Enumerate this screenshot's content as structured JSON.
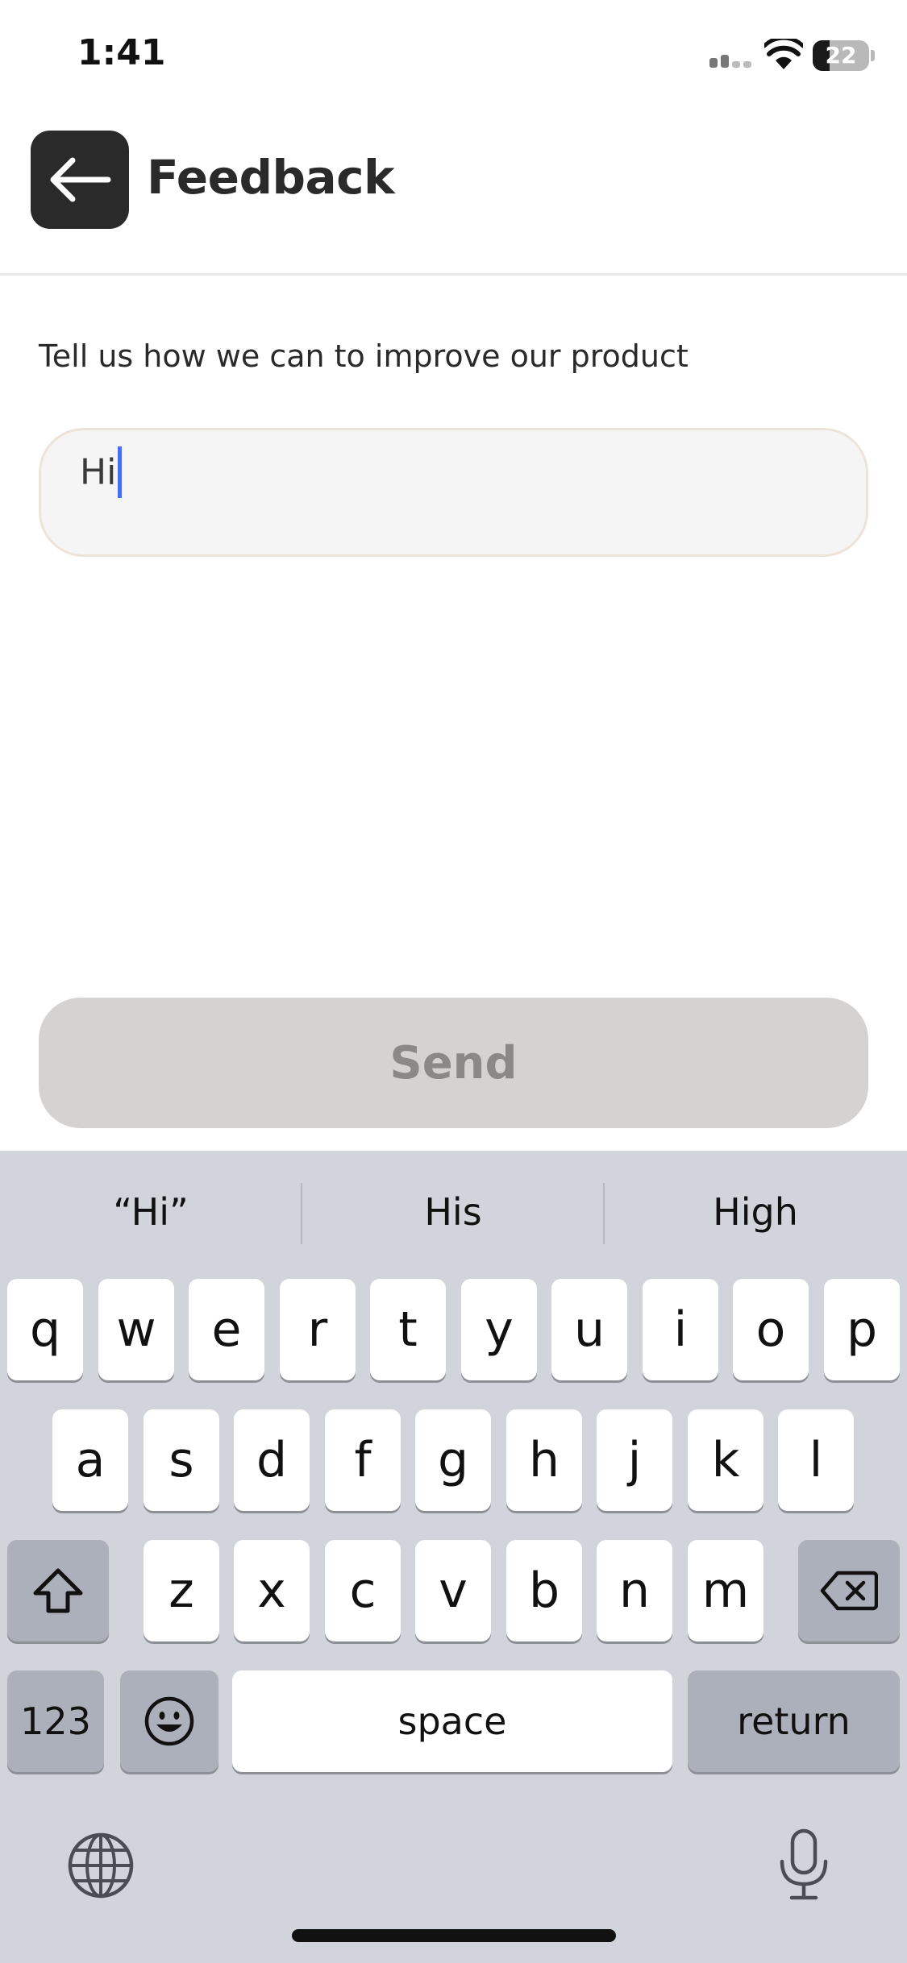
{
  "status_bar": {
    "time": "1:41",
    "battery": "22"
  },
  "header": {
    "title": "Feedback"
  },
  "main": {
    "prompt": "Tell us how we can to improve our product",
    "feedback_value": "Hi",
    "send_label": "Send"
  },
  "keyboard": {
    "suggestions": [
      "“Hi”",
      "His",
      "High"
    ],
    "row1": [
      "q",
      "w",
      "e",
      "r",
      "t",
      "y",
      "u",
      "i",
      "o",
      "p"
    ],
    "row2": [
      "a",
      "s",
      "d",
      "f",
      "g",
      "h",
      "j",
      "k",
      "l"
    ],
    "row3": [
      "z",
      "x",
      "c",
      "v",
      "b",
      "n",
      "m"
    ],
    "numbers_label": "123",
    "space_label": "space",
    "return_label": "return"
  },
  "icons": {
    "back": "arrow-left-icon",
    "shift": "shift-icon",
    "delete": "delete-icon",
    "emoji": "emoji-icon",
    "globe": "globe-icon",
    "mic": "microphone-icon"
  },
  "colors": {
    "caret": "#4a6cf7",
    "send_disabled_bg": "#d5d3d1",
    "keyboard_bg": "#d1d4db"
  }
}
